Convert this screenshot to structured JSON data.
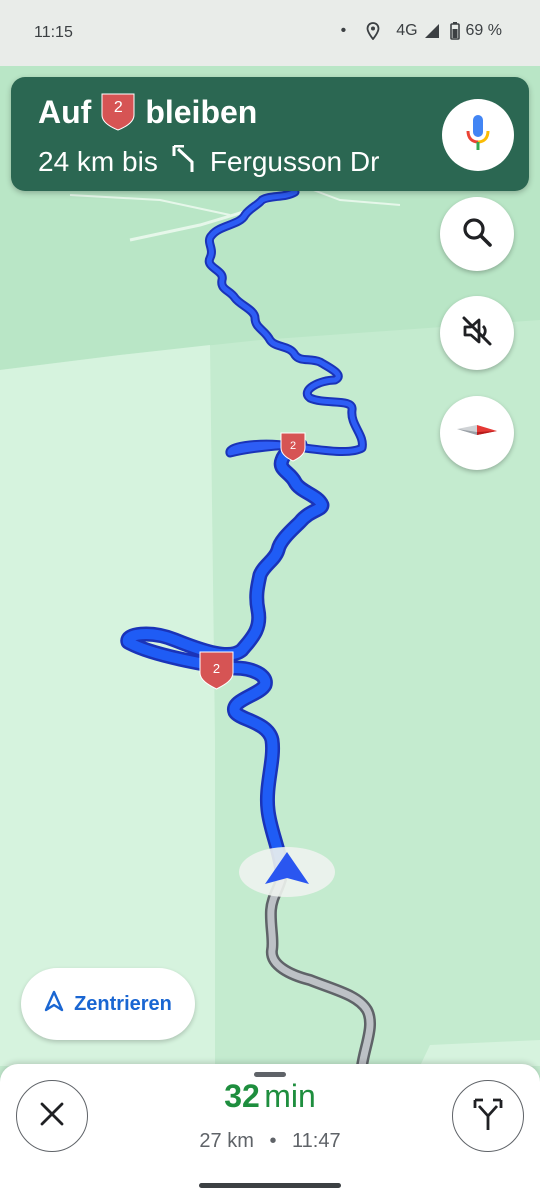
{
  "status_bar": {
    "time": "11:15",
    "dot": "•",
    "network": "4G",
    "battery": "69 %"
  },
  "banner": {
    "instruction_prefix": "Auf",
    "route_shield_number": "2",
    "instruction_suffix": "bleiben",
    "distance": "24 km bis",
    "turn_icon": "turn-slight-left-icon",
    "street": "Fergusson Dr",
    "background_color": "#2b6752"
  },
  "map": {
    "route_shields": [
      {
        "number": "2"
      },
      {
        "number": "2"
      }
    ],
    "route_color": "#1a4ff0",
    "traveled_color": "#9aa0a6"
  },
  "controls": {
    "search_icon": "search-icon",
    "sound_icon": "sound-off-icon",
    "compass_icon": "compass-icon",
    "recenter_label": "Zentrieren"
  },
  "bottom_sheet": {
    "duration_value": "32",
    "duration_unit": "min",
    "distance": "27 km",
    "separator": "•",
    "arrival_time": "11:47",
    "close_icon": "close-icon",
    "routes_icon": "alternate-routes-icon"
  }
}
